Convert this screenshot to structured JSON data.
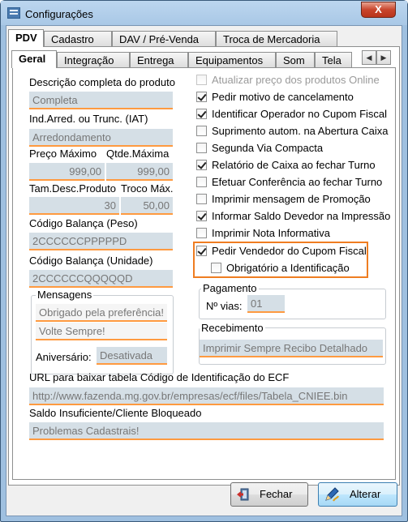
{
  "window": {
    "title": "Configurações",
    "close": "X"
  },
  "tabs_top": [
    {
      "label": "PDV"
    },
    {
      "label": "Cadastro"
    },
    {
      "label": "DAV / Pré-Venda"
    },
    {
      "label": "Troca de Mercadoria"
    }
  ],
  "tabs_sub": [
    {
      "label": "Geral"
    },
    {
      "label": "Integração"
    },
    {
      "label": "Entrega"
    },
    {
      "label": "Equipamentos"
    },
    {
      "label": "Som"
    },
    {
      "label": "Tela"
    }
  ],
  "left": {
    "descricao": {
      "label": "Descrição completa do produto",
      "value": "Completa"
    },
    "arred": {
      "label": "Ind.Arred. ou Trunc. (IAT)",
      "value": "Arredondamento"
    },
    "preco_max": {
      "label": "Preço Máximo",
      "value": "999,00"
    },
    "qtde_max": {
      "label": "Qtde.Máxima",
      "value": "999,00"
    },
    "tam_desc": {
      "label": "Tam.Desc.Produto",
      "value": "30"
    },
    "troco_max": {
      "label": "Troco Máx.",
      "value": "50,00"
    },
    "balanca_peso": {
      "label": "Código Balança (Peso)",
      "value": "2CCCCCCPPPPPD"
    },
    "balanca_unid": {
      "label": "Código Balança (Unidade)",
      "value": "2CCCCCCQQQQQD"
    }
  },
  "mensagens": {
    "title": "Mensagens",
    "msg1": "Obrigado pela preferência!",
    "msg2": "Volte Sempre!",
    "aniversario_label": "Aniversário:",
    "aniversario_value": "Desativada"
  },
  "checks": [
    {
      "label": "Atualizar preço dos produtos Online",
      "checked": false,
      "disabled": true
    },
    {
      "label": "Pedir motivo de cancelamento",
      "checked": true
    },
    {
      "label": "Identificar Operador no Cupom Fiscal",
      "checked": true
    },
    {
      "label": "Suprimento autom. na Abertura Caixa",
      "checked": false
    },
    {
      "label": "Segunda Via Compacta",
      "checked": false
    },
    {
      "label": "Relatório de Caixa ao fechar Turno",
      "checked": true
    },
    {
      "label": "Efetuar Conferência ao fechar Turno",
      "checked": false
    },
    {
      "label": "Imprimir mensagem de Promoção",
      "checked": false
    },
    {
      "label": "Informar Saldo Devedor na Impressão",
      "checked": true
    },
    {
      "label": "Imprimir Nota Informativa",
      "checked": false
    },
    {
      "label": "Pedir Vendedor do Cupom Fiscal",
      "checked": true
    },
    {
      "label": "Obrigatório a Identificação",
      "checked": false
    }
  ],
  "pagamento": {
    "title": "Pagamento",
    "vias_label": "Nº vias:",
    "vias_value": "01"
  },
  "recebimento": {
    "title": "Recebimento",
    "value": "Imprimir Sempre Recibo Detalhado"
  },
  "url_ecf": {
    "label": "URL para baixar tabela Código de Identificação do ECF",
    "value": "http://www.fazenda.mg.gov.br/empresas/ecf/files/Tabela_CNIEE.bin"
  },
  "saldo": {
    "label": "Saldo Insuficiente/Cliente Bloqueado",
    "value": "Problemas Cadastrais!"
  },
  "buttons": {
    "fechar": "Fechar",
    "alterar": "Alterar"
  },
  "colors": {
    "accent": "#ff9a40",
    "field_bg": "#d5dfe6",
    "highlight_box": "#ef7d21"
  }
}
